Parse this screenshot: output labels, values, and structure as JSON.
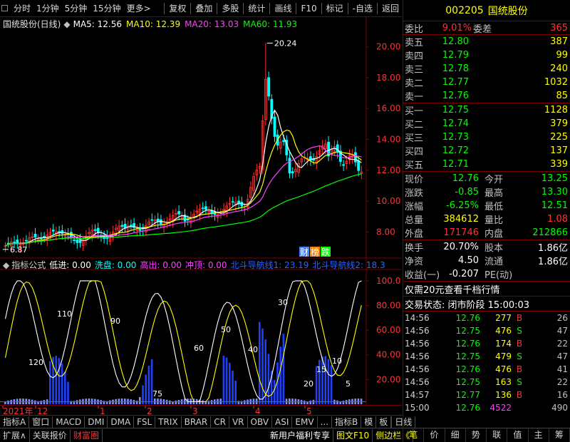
{
  "toolbar": {
    "left": [
      "分时",
      "1分钟",
      "5分钟",
      "15分钟",
      "更多>"
    ],
    "right": [
      "复权",
      "叠加",
      "多股",
      "统计",
      "画线",
      "F10",
      "标记",
      "-自选",
      "返回"
    ]
  },
  "ma_legend": {
    "name": "国统股份(日线)",
    "items": [
      {
        "label": "MA5: 12.56",
        "color": "#ffffff"
      },
      {
        "label": "MA10: 12.39",
        "color": "#ffff00"
      },
      {
        "label": "MA20: 13.03",
        "color": "#ff40ff"
      },
      {
        "label": "MA60: 11.93",
        "color": "#00ff00"
      }
    ]
  },
  "indicator_legend": {
    "items": [
      {
        "label": "指标公式",
        "color": "#d0d0d0"
      },
      {
        "label": "低进: 0.00",
        "color": "#ffffff"
      },
      {
        "label": "洗盘: 0.00",
        "color": "#00ffff"
      },
      {
        "label": "高出: 0.00",
        "color": "#ff40ff"
      },
      {
        "label": "冲顶: 0.00",
        "color": "#ff40ff"
      },
      {
        "label": "北斗导航线1: 23.19",
        "color": "#3060ff"
      },
      {
        "label": "北斗导航线2: 18.3",
        "color": "#3060ff"
      }
    ]
  },
  "main_chart": {
    "y_axis": [
      "20.00",
      "18.00",
      "16.00",
      "14.00",
      "12.00",
      "10.00",
      "8.00"
    ],
    "ylim": [
      6.4,
      21.0
    ],
    "high_label": "20.24",
    "low_label": "6.87",
    "badges": [
      {
        "text": "财",
        "color": "#4080ff"
      },
      {
        "text": "榜",
        "color": "#ff8000"
      },
      {
        "text": "跌",
        "color": "#00ff00"
      }
    ]
  },
  "indicator_chart": {
    "y_axis": [
      "100.0",
      "80.00",
      "60.00",
      "40.00",
      "20.00"
    ],
    "ylim": [
      0,
      108
    ],
    "labels": [
      {
        "text": "120",
        "color": "#ffffff"
      },
      {
        "text": "110",
        "color": "#ffffff"
      },
      {
        "text": "90",
        "color": "#ffffff"
      },
      {
        "text": "75",
        "color": "#ffffff"
      },
      {
        "text": "60",
        "color": "#ffffff"
      },
      {
        "text": "50",
        "color": "#ffffff"
      },
      {
        "text": "40",
        "color": "#ffffff"
      },
      {
        "text": "30",
        "color": "#ffffff"
      },
      {
        "text": "20",
        "color": "#ffffff"
      },
      {
        "text": "15",
        "color": "#ffffff"
      },
      {
        "text": "10",
        "color": "#ffffff"
      },
      {
        "text": "5",
        "color": "#ffffff"
      }
    ]
  },
  "date_axis": [
    "2021年",
    "12",
    "1",
    "2",
    "3",
    "4",
    "5"
  ],
  "tabs": [
    "指标A",
    "窗口",
    "MACD",
    "DMI",
    "DMA",
    "FSL",
    "TRIX",
    "BRAR",
    "CR",
    "VR",
    "OBV",
    "ASI",
    "EMV",
    "...",
    "指标B",
    "模",
    "板"
  ],
  "tab_right": "日线",
  "bottom_tabs": [
    {
      "text": "扩展∧",
      "color": "#d0d0d0"
    },
    {
      "text": "关联报价",
      "color": "#d0d0d0"
    },
    {
      "text": "财富圈",
      "color": "#ff3232"
    }
  ],
  "bottom_right": [
    {
      "text": "新用户福利专享",
      "color": "#ffffff"
    },
    {
      "text": "图文F10",
      "color": "#ffff00"
    },
    {
      "text": "侧边栏《",
      "color": "#ffff00"
    }
  ],
  "stock": {
    "code": "002205",
    "name": "国统股份"
  },
  "weibi": {
    "label": "委比",
    "value": "9.01%",
    "label2": "委差",
    "value2": "365"
  },
  "sell_levels": [
    {
      "label": "卖五",
      "price": "12.80",
      "vol": "387"
    },
    {
      "label": "卖四",
      "price": "12.79",
      "vol": "99"
    },
    {
      "label": "卖三",
      "price": "12.78",
      "vol": "240"
    },
    {
      "label": "卖二",
      "price": "12.77",
      "vol": "1032"
    },
    {
      "label": "卖一",
      "price": "12.76",
      "vol": "85"
    }
  ],
  "buy_levels": [
    {
      "label": "买一",
      "price": "12.75",
      "vol": "1128"
    },
    {
      "label": "买二",
      "price": "12.74",
      "vol": "379"
    },
    {
      "label": "买三",
      "price": "12.73",
      "vol": "225"
    },
    {
      "label": "买四",
      "price": "12.72",
      "vol": "137"
    },
    {
      "label": "买五",
      "price": "12.71",
      "vol": "339"
    }
  ],
  "quote_stats": [
    {
      "l1": "现价",
      "v1": "12.76",
      "c1": "#00ff00",
      "l2": "今开",
      "v2": "13.25",
      "c2": "#00ff00"
    },
    {
      "l1": "涨跌",
      "v1": "-0.85",
      "c1": "#00ff00",
      "l2": "最高",
      "v2": "13.30",
      "c2": "#00ff00"
    },
    {
      "l1": "涨幅",
      "v1": "-6.25%",
      "c1": "#00ff00",
      "l2": "最低",
      "v2": "12.51",
      "c2": "#00ff00"
    },
    {
      "l1": "总量",
      "v1": "384612",
      "c1": "#ffff00",
      "l2": "量比",
      "v2": "1.08",
      "c2": "#ff3232"
    },
    {
      "l1": "外盘",
      "v1": "171746",
      "c1": "#ff3232",
      "l2": "内盘",
      "v2": "212866",
      "c2": "#00ff00"
    }
  ],
  "fundamentals": [
    {
      "l1": "换手",
      "v1": "20.70%",
      "l2": "股本",
      "v2": "1.86亿"
    },
    {
      "l1": "净资",
      "v1": "4.50",
      "l2": "流通",
      "v2": "1.86亿"
    },
    {
      "l1": "收益(一)",
      "v1": "-0.207",
      "l2": "PE(动)",
      "v2": ""
    }
  ],
  "promo": "仅需20元查看千档行情",
  "trade_status": "交易状态: 闭市阶段 15:00:03",
  "ticks": [
    {
      "time": "14:56",
      "price": "12.76",
      "vol": "277",
      "bs": "B",
      "n": "26"
    },
    {
      "time": "14:56",
      "price": "12.75",
      "vol": "476",
      "bs": "S",
      "n": "47"
    },
    {
      "time": "14:56",
      "price": "12.76",
      "vol": "174",
      "bs": "B",
      "n": "22"
    },
    {
      "time": "14:56",
      "price": "12.75",
      "vol": "479",
      "bs": "S",
      "n": "47"
    },
    {
      "time": "14:56",
      "price": "12.76",
      "vol": "476",
      "bs": "B",
      "n": "41"
    },
    {
      "time": "14:56",
      "price": "12.75",
      "vol": "163",
      "bs": "S",
      "n": "22"
    },
    {
      "time": "14:57",
      "price": "12.77",
      "vol": "136",
      "bs": "B",
      "n": "16"
    },
    {
      "time": "15:00",
      "price": "12.76",
      "vol": "4522",
      "bs": "",
      "n": "490"
    }
  ],
  "right_tabs": [
    "笔",
    "价",
    "细",
    "势",
    "联",
    "值",
    "主",
    "筹"
  ],
  "colors": {
    "up": "#ff3232",
    "down": "#00ff00",
    "frame": "#7a0000",
    "ma5": "#ffffff",
    "ma10": "#ffff00",
    "ma20": "#ff40ff",
    "ma60": "#00ff00",
    "bar": "#2040ff"
  }
}
